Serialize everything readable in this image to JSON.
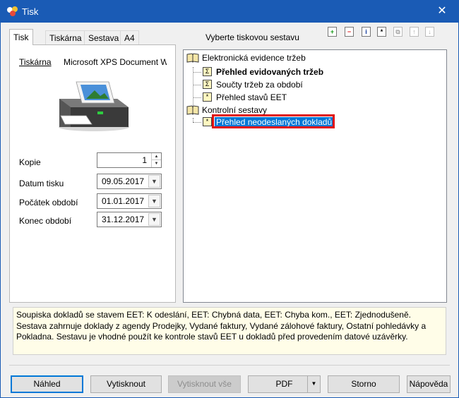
{
  "window": {
    "title": "Tisk",
    "close_glyph": "✕"
  },
  "tabs": [
    "Tisk",
    "Tiskárna",
    "Sestava",
    "A4"
  ],
  "left_panel": {
    "printer_label": "Tiskárna",
    "printer_name": "Microsoft XPS Document Writer",
    "fields": {
      "copies": {
        "label": "Kopie",
        "value": "1"
      },
      "print_date": {
        "label": "Datum tisku",
        "value": "09.05.2017"
      },
      "period_start": {
        "label": "Počátek období",
        "value": "01.01.2017"
      },
      "period_end": {
        "label": "Konec období",
        "value": "31.12.2017"
      }
    }
  },
  "report_tree": {
    "header": "Vyberte tiskovou sestavu",
    "toolbar_icons": [
      "add-icon",
      "remove-icon",
      "info-icon",
      "star-icon",
      "copy-icon",
      "move-up-icon",
      "move-down-icon"
    ],
    "groups": [
      {
        "label": "Elektronická evidence tržeb",
        "items": [
          {
            "label": "Přehled evidovaných tržeb",
            "icon": "sigma-icon",
            "bold": true
          },
          {
            "label": "Součty tržeb za období",
            "icon": "sigma-icon"
          },
          {
            "label": "Přehled stavů EET",
            "icon": "star-doc-icon"
          }
        ]
      },
      {
        "label": "Kontrolní sestavy",
        "items": [
          {
            "label": "Přehled neodeslaných dokladů",
            "icon": "star-doc-icon",
            "selected": true
          }
        ]
      }
    ]
  },
  "description": "Soupiska dokladů se stavem EET: K odeslání, EET: Chybná data, EET: Chyba kom., EET: Zjednodušeně. Sestava zahrnuje doklady z agendy Prodejky, Vydané faktury, Vydané zálohové faktury, Ostatní pohledávky a Pokladna. Sestavu je vhodné použít ke kontrole stavů EET u dokladů před provedením datové uzávěrky.",
  "buttons": {
    "preview": "Náhled",
    "print": "Vytisknout",
    "print_all": "Vytisknout vše",
    "pdf": "PDF",
    "cancel": "Storno",
    "help": "Nápověda"
  },
  "colors": {
    "titlebar": "#1a5bb5",
    "selection": "#0078d7",
    "highlight_frame": "#e01010"
  }
}
